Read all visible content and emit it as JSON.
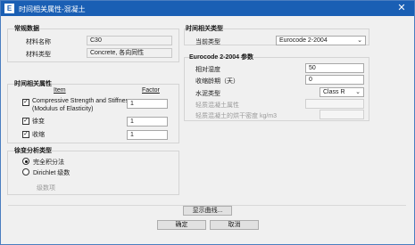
{
  "window": {
    "title": "时间相关属性-混凝土",
    "app_icon": "E",
    "close_glyph": "✕"
  },
  "regular": {
    "label": "常规数据",
    "material_name_label": "材料名称",
    "material_name_value": "C30",
    "material_type_label": "材料类型",
    "material_type_value": "Concrete, 各向同性"
  },
  "time_props": {
    "label": "时间相关属性",
    "col_item": "Item",
    "col_factor": "Factor",
    "rows": [
      {
        "checked": true,
        "label": "Compressive Strength and Stiffness",
        "label2": "(Modulus of Elasticity)",
        "factor": "1"
      },
      {
        "checked": true,
        "label": "徐变",
        "label2": "",
        "factor": "1"
      },
      {
        "checked": true,
        "label": "收缩",
        "label2": "",
        "factor": "1"
      }
    ],
    "check_glyph": "✓"
  },
  "creep_analysis": {
    "label": "徐变分析类型",
    "options": [
      {
        "label": "完全积分法",
        "selected": true
      },
      {
        "label": "Dirichlet 级数",
        "selected": false
      }
    ],
    "series_label": "级数项"
  },
  "time_type": {
    "label": "时间相关类型",
    "current_label": "当前类型",
    "current_value": "Eurocode 2-2004"
  },
  "eurocode": {
    "label": "Eurocode 2-2004 参数",
    "humidity_label": "相对湿度",
    "humidity_value": "50",
    "shrink_age_label": "收缩龄期（天）",
    "shrink_age_value": "0",
    "cement_label": "水泥类型",
    "cement_value": "Class R",
    "lw_label": "轻质混凝土属性",
    "lw_density_label": "轻质混凝土的烘干密度 kg/m3"
  },
  "buttons": {
    "show_curves": "显示曲线...",
    "ok": "确定",
    "cancel": "取消"
  }
}
